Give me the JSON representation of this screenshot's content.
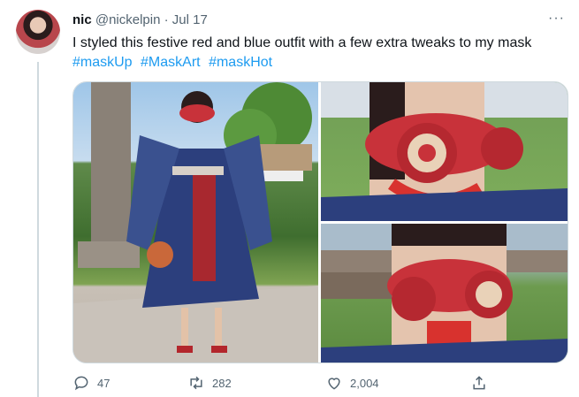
{
  "tweet": {
    "display_name": "nic",
    "handle": "@nickelpin",
    "separator": "·",
    "date": "Jul 17",
    "more_glyph": "···",
    "text": "I styled this festive red and blue outfit with a few extra tweaks to my mask",
    "hashtags": [
      "#maskUp",
      "#MaskArt",
      "#maskHot"
    ]
  },
  "actions": {
    "replies": "47",
    "retweets": "282",
    "likes": "2,004"
  },
  "colors": {
    "link": "#1d9bf0",
    "secondary_text": "#536471",
    "border": "#cfd9de",
    "mask_red": "#c8323a",
    "dress_blue": "#2c3f7d"
  },
  "icons": {
    "reply": "reply-icon",
    "retweet": "retweet-icon",
    "like": "heart-icon",
    "share": "share-icon",
    "more": "more-icon"
  }
}
